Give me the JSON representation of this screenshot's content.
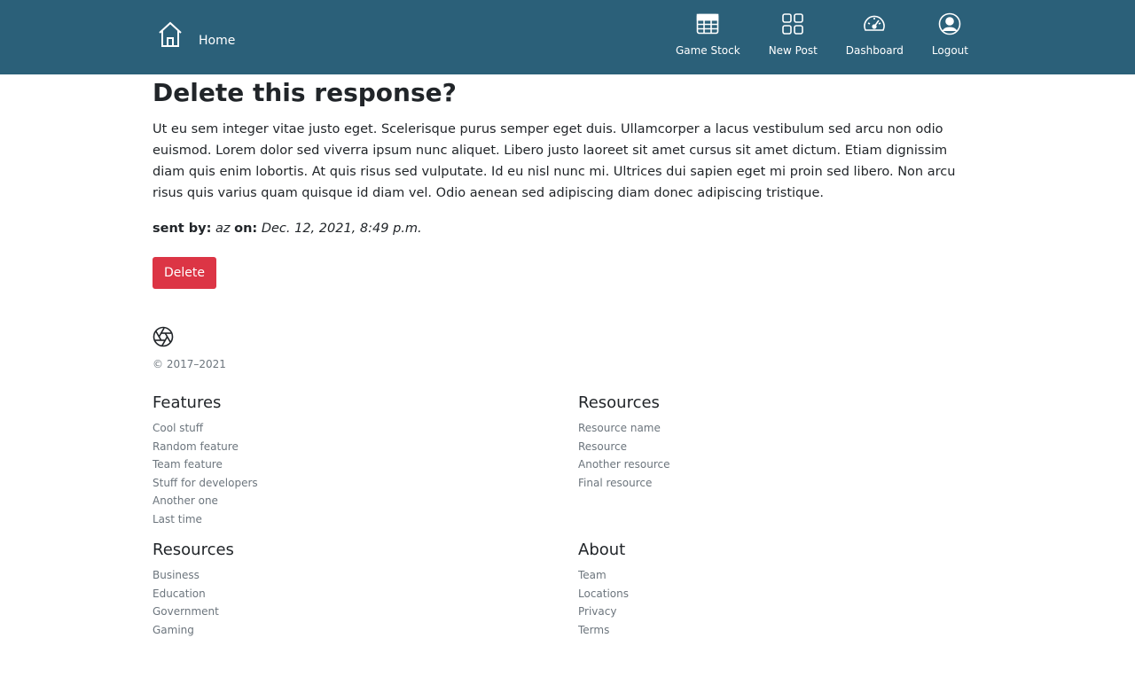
{
  "nav": {
    "brand_label": "Home",
    "items": [
      {
        "label": "Game Stock",
        "icon": "table-grid-icon"
      },
      {
        "label": "New Post",
        "icon": "four-squares-icon"
      },
      {
        "label": "Dashboard",
        "icon": "speedometer-icon"
      },
      {
        "label": "Logout",
        "icon": "user-circle-icon"
      }
    ]
  },
  "main": {
    "title": "Delete this response?",
    "body": "Ut eu sem integer vitae justo eget. Scelerisque purus semper eget duis. Ullamcorper a lacus vestibulum sed arcu non odio euismod. Lorem dolor sed viverra ipsum nunc aliquet. Libero justo laoreet sit amet cursus sit amet dictum. Etiam dignissim diam quis enim lobortis. At quis risus sed vulputate. Id eu nisl nunc mi. Ultrices dui sapien eget mi proin sed libero. Non arcu risus quis varius quam quisque id diam vel. Odio aenean sed adipiscing diam donec adipiscing tristique.",
    "sent_by_label": "sent by:",
    "sent_by_value": "az",
    "on_label": "on:",
    "on_value": "Dec. 12, 2021, 8:49 p.m.",
    "delete_label": "Delete"
  },
  "colors": {
    "navbar": "#2b6079",
    "danger": "#dc3545",
    "muted": "#6c757d"
  },
  "footer": {
    "logo_icon": "aperture-icon",
    "copyright": "© 2017–2021",
    "columns": [
      {
        "heading": "Features",
        "links": [
          "Cool stuff",
          "Random feature",
          "Team feature",
          "Stuff for developers",
          "Another one",
          "Last time"
        ]
      },
      {
        "heading": "Resources",
        "links": [
          "Resource name",
          "Resource",
          "Another resource",
          "Final resource"
        ]
      },
      {
        "heading": "Resources",
        "links": [
          "Business",
          "Education",
          "Government",
          "Gaming"
        ]
      },
      {
        "heading": "About",
        "links": [
          "Team",
          "Locations",
          "Privacy",
          "Terms"
        ]
      }
    ]
  }
}
